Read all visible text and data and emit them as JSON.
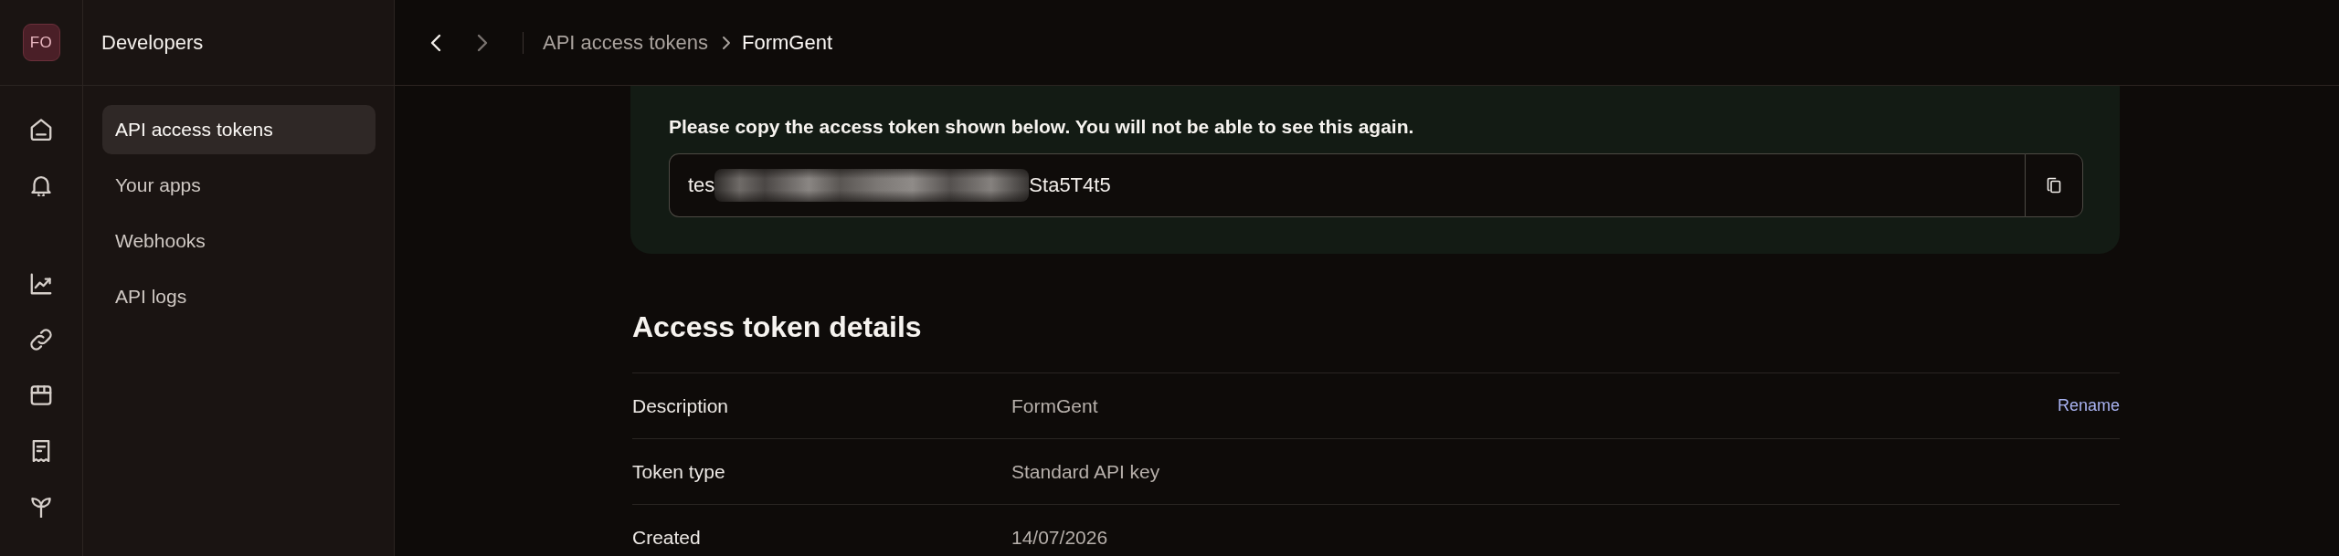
{
  "workspace": {
    "initials": "FO"
  },
  "sidebar": {
    "title": "Developers",
    "items": [
      {
        "label": "API access tokens",
        "selected": true
      },
      {
        "label": "Your apps",
        "selected": false
      },
      {
        "label": "Webhooks",
        "selected": false
      },
      {
        "label": "API logs",
        "selected": false
      }
    ]
  },
  "topbar": {
    "nav": [
      {
        "kind": "back",
        "disabled": false
      },
      {
        "kind": "forward",
        "disabled": true
      }
    ],
    "breadcrumb": [
      {
        "label": "API access tokens",
        "current": false
      },
      {
        "label": "FormGent",
        "current": true
      }
    ]
  },
  "token_notice": {
    "message": "Please copy the access token shown below. You will not be able to see this again.",
    "token_start": "tes",
    "masked": true,
    "token_end": "Sta5T4t5"
  },
  "details": {
    "title": "Access token details",
    "rows": [
      {
        "label": "Description",
        "value": "FormGent",
        "action": "Rename"
      },
      {
        "label": "Token type",
        "value": "Standard API key"
      },
      {
        "label": "Created",
        "value": "14/07/2026"
      }
    ]
  }
}
